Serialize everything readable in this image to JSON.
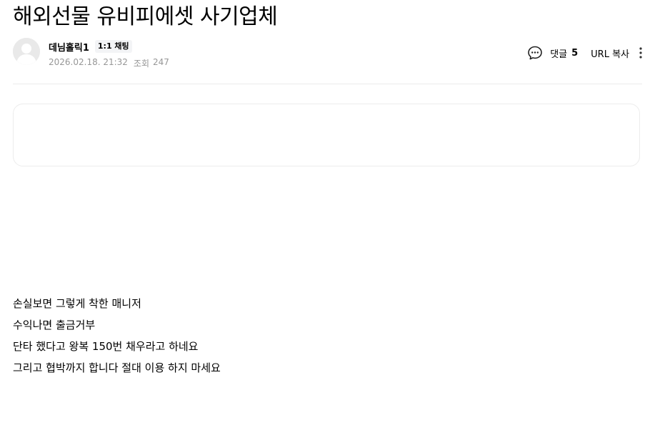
{
  "post": {
    "title": "해외선물 유비피에셋 사기업체",
    "author": {
      "name": "데님홀릭1",
      "chat_badge": "1:1 채팅",
      "avatar_icon": "default-user-avatar"
    },
    "meta": {
      "datetime": "2026.02.18. 21:32",
      "views_label": "조회",
      "views_count": "247"
    },
    "actions": {
      "comment_icon": "speech-bubble-icon",
      "comment_label": "댓글",
      "comment_count": "5",
      "url_copy_label": "URL 복사",
      "more_icon": "vertical-ellipsis-icon"
    },
    "body_lines": [
      "손실보면 그렇게 착한 매니저",
      "수익나면 출금거부",
      "단타 했다고 왕복 150번 채우라고 하네요",
      "그리고 협박까지 합니다 절대 이용 하지 마세요"
    ]
  },
  "colors": {
    "text": "#000000",
    "meta_text": "#979797",
    "divider": "#ebebeb",
    "badge_bg": "#f3f4f6",
    "avatar_bg": "#e9e9e9"
  }
}
